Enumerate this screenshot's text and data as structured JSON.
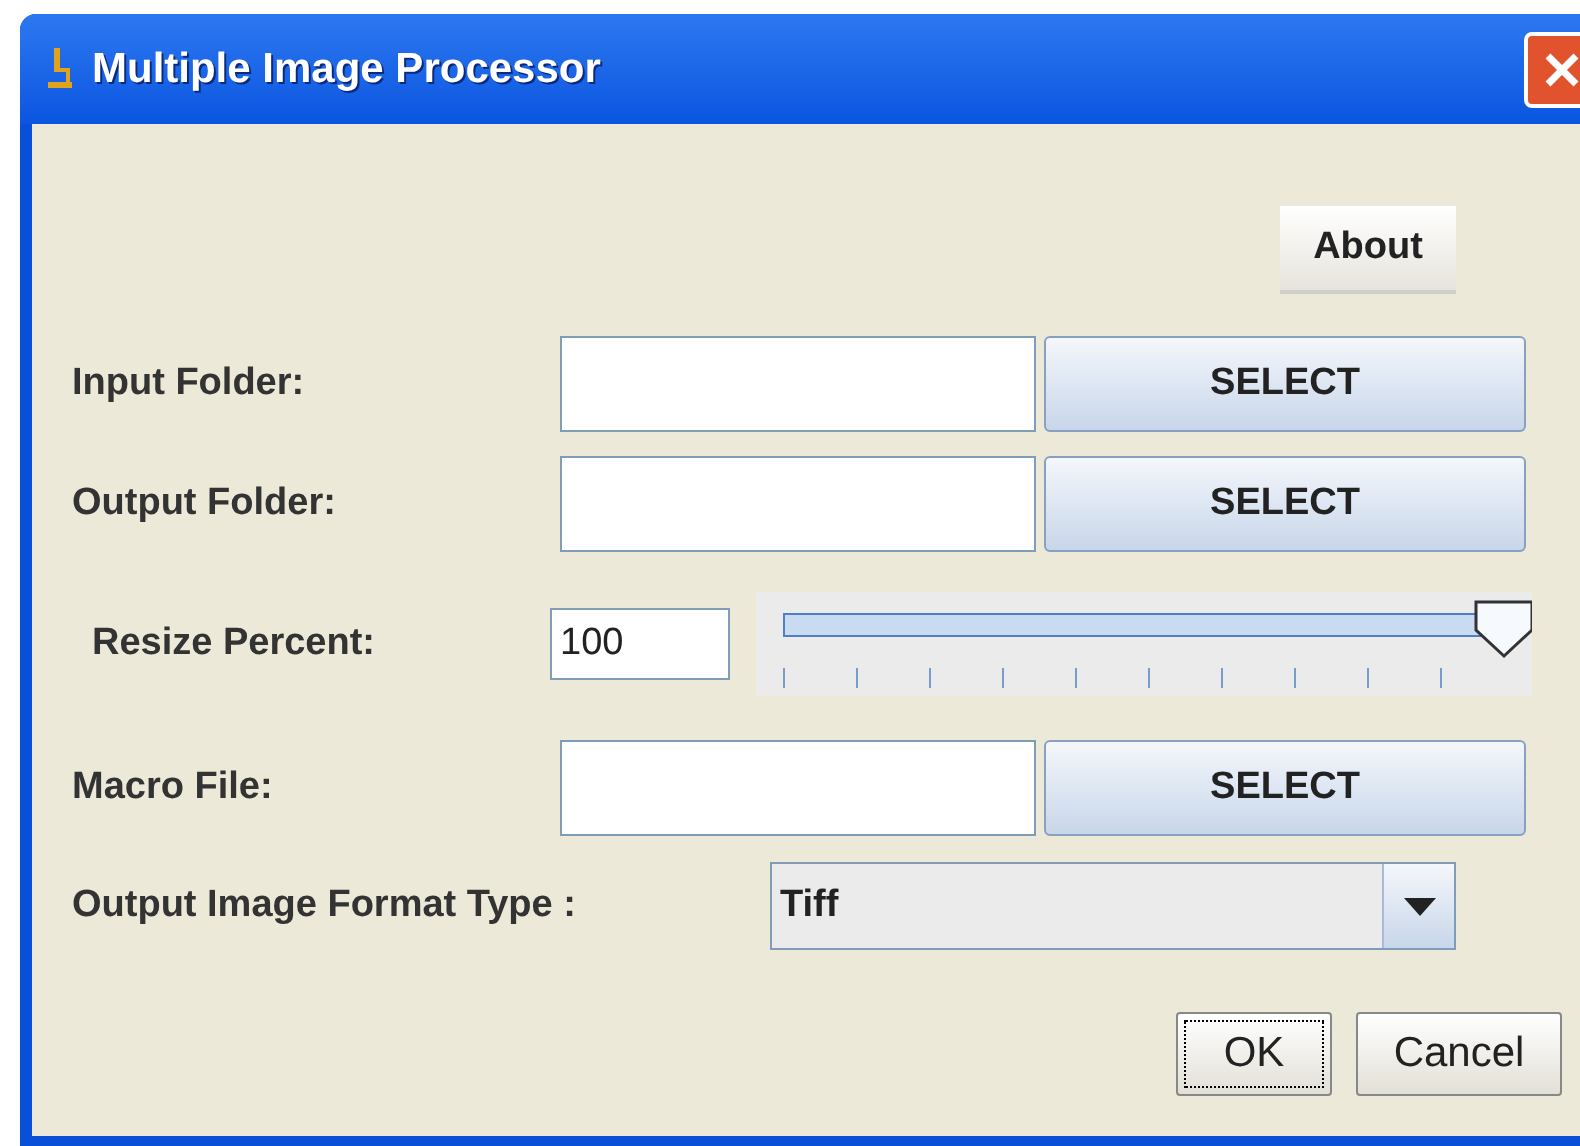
{
  "window": {
    "title": "Multiple Image Processor"
  },
  "about_button": {
    "label": "About"
  },
  "folder_rows": [
    {
      "label": "Input Folder:",
      "button": "SELECT"
    },
    {
      "label": "Output Folder:",
      "button": "SELECT"
    }
  ],
  "resize": {
    "label": "Resize Percent:",
    "value": "100",
    "level": 1.0
  },
  "macro_row": {
    "label": "Macro File:",
    "button": "SELECT"
  },
  "format": {
    "label": "Output Image Format Type :",
    "value": "Tiff"
  },
  "dialog_buttons": [
    {
      "label": "OK",
      "focused": true
    },
    {
      "label": "Cancel",
      "focused": false
    }
  ]
}
